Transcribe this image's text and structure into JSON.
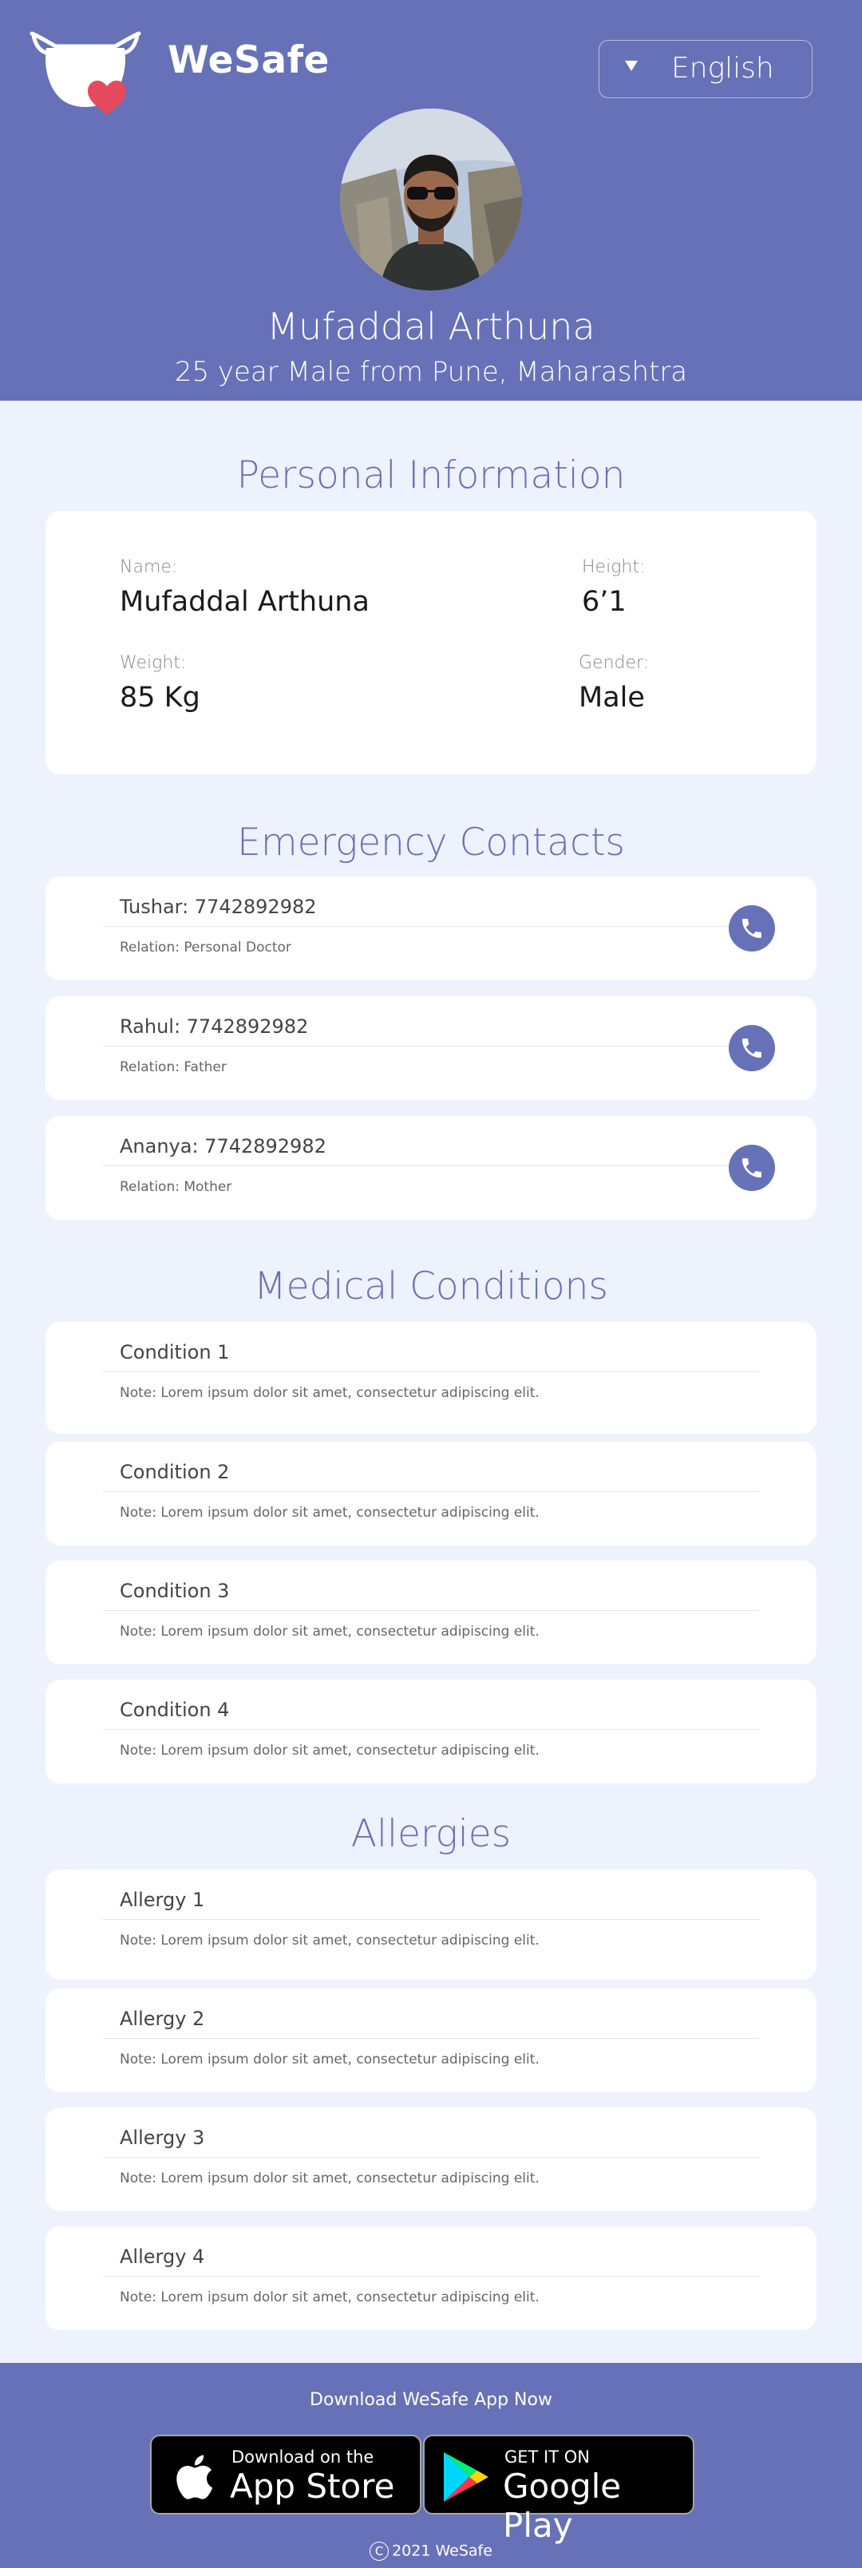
{
  "app": {
    "brand": "WeSafe",
    "language": "English"
  },
  "profile": {
    "name": "Mufaddal Arthuna",
    "subtitle": "25 year Male from Pune, Maharashtra"
  },
  "personal": {
    "section_title": "Personal Information",
    "name_label": "Name:",
    "name_value": "Mufaddal Arthuna",
    "height_label": "Height:",
    "height_value": "6’1",
    "weight_label": "Weight:",
    "weight_value": "85 Kg",
    "gender_label": "Gender:",
    "gender_value": "Male"
  },
  "emergency": {
    "section_title": "Emergency Contacts",
    "contacts": [
      {
        "title": "Tushar: 7742892982",
        "relation": "Relation: Personal Doctor"
      },
      {
        "title": "Rahul: 7742892982",
        "relation": "Relation: Father"
      },
      {
        "title": "Ananya: 7742892982",
        "relation": "Relation: Mother"
      }
    ]
  },
  "medical": {
    "section_title": "Medical Conditions",
    "items": [
      {
        "title": "Condition 1",
        "note": "Note: Lorem ipsum dolor sit amet, consectetur adipiscing elit."
      },
      {
        "title": "Condition 2",
        "note": "Note: Lorem ipsum dolor sit amet, consectetur adipiscing elit."
      },
      {
        "title": "Condition 3",
        "note": "Note: Lorem ipsum dolor sit amet, consectetur adipiscing elit."
      },
      {
        "title": "Condition 4",
        "note": "Note: Lorem ipsum dolor sit amet, consectetur adipiscing elit."
      }
    ]
  },
  "allergies": {
    "section_title": "Allergies",
    "items": [
      {
        "title": "Allergy 1",
        "note": "Note: Lorem ipsum dolor sit amet, consectetur adipiscing elit."
      },
      {
        "title": "Allergy  2",
        "note": "Note: Lorem ipsum dolor sit amet, consectetur adipiscing elit."
      },
      {
        "title": "Allergy  3",
        "note": "Note: Lorem ipsum dolor sit amet, consectetur adipiscing elit."
      },
      {
        "title": "Allergy  4",
        "note": "Note: Lorem ipsum dolor sit amet, consectetur adipiscing elit."
      }
    ]
  },
  "footer": {
    "download_text": "Download WeSafe App Now",
    "appstore_small": "Download on the",
    "appstore_big": "App Store",
    "playstore_small": "GET IT ON",
    "playstore_big": "Google Play",
    "copyright": "2021 WeSafe"
  },
  "colors": {
    "primary": "#6771b7",
    "background": "#eef2fd",
    "card": "#ffffff",
    "heart": "#e64a5f"
  },
  "icons": [
    "mask-heart-logo-icon",
    "caret-down-icon",
    "phone-icon",
    "apple-icon",
    "google-play-icon",
    "copyright-icon"
  ]
}
